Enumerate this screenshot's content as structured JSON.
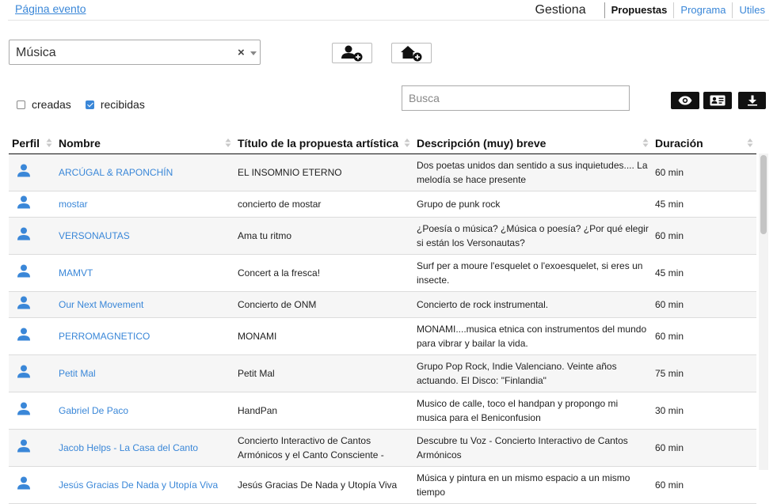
{
  "header": {
    "event_link": "Página evento",
    "section": "Gestiona",
    "tabs": [
      {
        "label": "Propuestas",
        "active": true
      },
      {
        "label": "Programa",
        "active": false
      },
      {
        "label": "Utiles",
        "active": false
      }
    ]
  },
  "filters": {
    "category_select": {
      "value": "Música",
      "clear_glyph": "×"
    },
    "add_artist_icon": "user-plus-icon",
    "add_space_icon": "home-plus-icon",
    "checkboxes": [
      {
        "label": "creadas",
        "checked": false
      },
      {
        "label": "recibidas",
        "checked": true
      }
    ],
    "search": {
      "placeholder": "Busca",
      "value": ""
    },
    "actions": [
      "eye-icon",
      "id-card-icon",
      "download-icon"
    ]
  },
  "table": {
    "columns": [
      "Perfil",
      "Nombre",
      "Título de la propuesta artística",
      "Descripción (muy) breve",
      "Duración"
    ],
    "rows": [
      {
        "name": "ARCÚGAL & RAPONCHÍN",
        "title": "EL INSOMNIO ETERNO",
        "description": "Dos poetas unidos dan sentido a sus inquietudes.... La melodía se hace presente",
        "duration": "60 min"
      },
      {
        "name": "mostar",
        "title": "concierto de mostar",
        "description": "Grupo de punk rock",
        "duration": "45 min"
      },
      {
        "name": "VERSONAUTAS",
        "title": "Ama tu ritmo",
        "description": "¿Poesía o música? ¿Música o poesía? ¿Por qué elegir si están los Versonautas?",
        "duration": "60 min"
      },
      {
        "name": "MAMVT",
        "title": "Concert a la fresca!",
        "description": "Surf per a moure l'esquelet o l'exoesquelet, si eres un insecte.",
        "duration": "45 min"
      },
      {
        "name": "Our Next Movement",
        "title": "Concierto de ONM",
        "description": "Concierto de rock instrumental.",
        "duration": "60 min"
      },
      {
        "name": "PERROMAGNETICO",
        "title": "MONAMI",
        "description": "MONAMI....musica etnica con instrumentos del mundo para vibrar y bailar la vida.",
        "duration": "60 min"
      },
      {
        "name": "Petit Mal",
        "title": "Petit Mal",
        "description": "Grupo Pop Rock, Indie Valenciano. Veinte años actuando. El Disco: \"Finlandia\"",
        "duration": "75 min"
      },
      {
        "name": "Gabriel De Paco",
        "title": "HandPan",
        "description": "Musico de calle, toco el handpan y propongo mi musica para el Beniconfusion",
        "duration": "30 min"
      },
      {
        "name": "Jacob Helps - La Casa del Canto",
        "title": "Concierto Interactivo de Cantos Armónicos y el Canto Consciente -",
        "description": "Descubre tu Voz - Concierto Interactivo de Cantos Armónicos",
        "duration": "60 min"
      },
      {
        "name": "Jesús Gracias De Nada y Utopía Viva",
        "title": "Jesús Gracias De Nada y Utopía Viva",
        "description": "Música y pintura en un mismo espacio a un mismo tiempo",
        "duration": "60 min"
      }
    ]
  },
  "colors": {
    "link": "#3a87d8",
    "user_icon": "#3a87d8",
    "action_button_bg": "#111111"
  }
}
